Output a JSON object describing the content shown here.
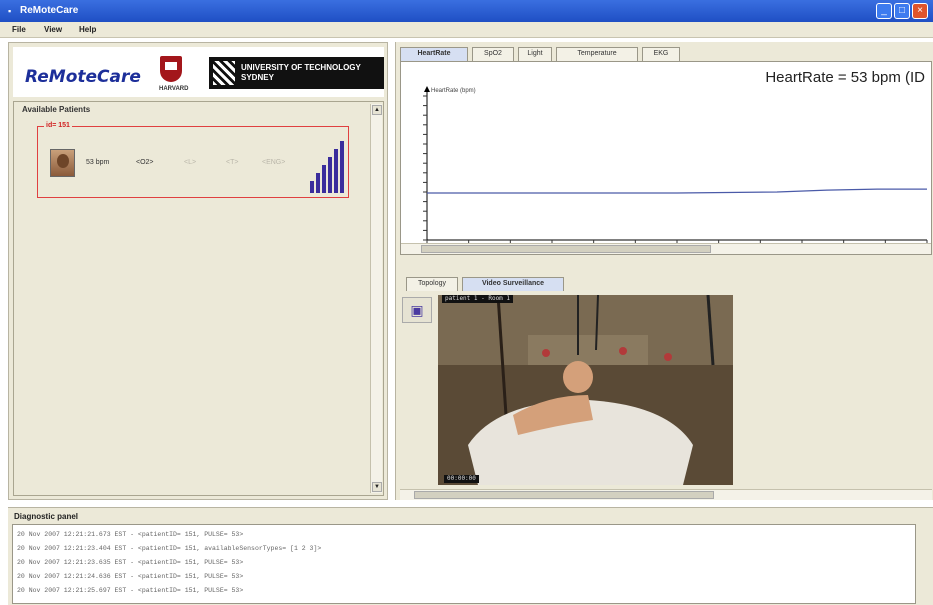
{
  "window": {
    "title": "ReMoteCare",
    "buttons": [
      "_",
      "□",
      "×"
    ]
  },
  "menu": [
    "File",
    "View",
    "Help"
  ],
  "logos": {
    "remotecare": "ReMoteCare",
    "harvard": "HARVARD",
    "uts": "UNIVERSITY OF TECHNOLOGY SYDNEY"
  },
  "patients_panel": {
    "title": "Available Patients",
    "patient": {
      "id_label": "id= 151",
      "pulse": "53 bpm",
      "spo2": "<O2>",
      "f1": "<L>",
      "f2": "<T>",
      "f3": "<ENG>",
      "signal_levels": [
        0.22,
        0.36,
        0.5,
        0.64,
        0.78,
        0.92
      ]
    }
  },
  "monitor_tabs": [
    "HeartRate",
    "SpO2",
    "Light",
    "Temperature",
    "EKG"
  ],
  "heart_rate_readout": "HeartRate = 53 bpm  (ID",
  "chart_data": {
    "type": "line",
    "ylabel": "HeartRate (bpm)",
    "ylim": [
      0,
      150
    ],
    "x": [
      0,
      10,
      20,
      30,
      40,
      50,
      60,
      70,
      80,
      90,
      100
    ],
    "series": [
      {
        "values": [
          49,
          49,
          49,
          49,
          49,
          49,
          49.5,
          50,
          52,
          53,
          53
        ]
      }
    ],
    "grid": false
  },
  "lower_tabs": [
    "Topology",
    "Video Surveillance"
  ],
  "camera_icon": "camera-icon",
  "video": {
    "top_caption": "patient 1 - Room 1",
    "bottom_caption": "00:00:00"
  },
  "diagnostic": {
    "title": "Diagnostic panel",
    "lines": [
      "20 Nov 2007 12:21:21.673 EST - <patientID= 151, PULSE= 53>",
      "20 Nov 2007 12:21:23.404 EST - <patientID= 151,  availableSensorTypes= [1 2 3]>",
      "20 Nov 2007 12:21:23.635 EST - <patientID= 151, PULSE= 53>",
      "20 Nov 2007 12:21:24.636 EST - <patientID= 151, PULSE= 53>",
      "20 Nov 2007 12:21:25.697 EST - <patientID= 151, PULSE= 53>"
    ]
  }
}
